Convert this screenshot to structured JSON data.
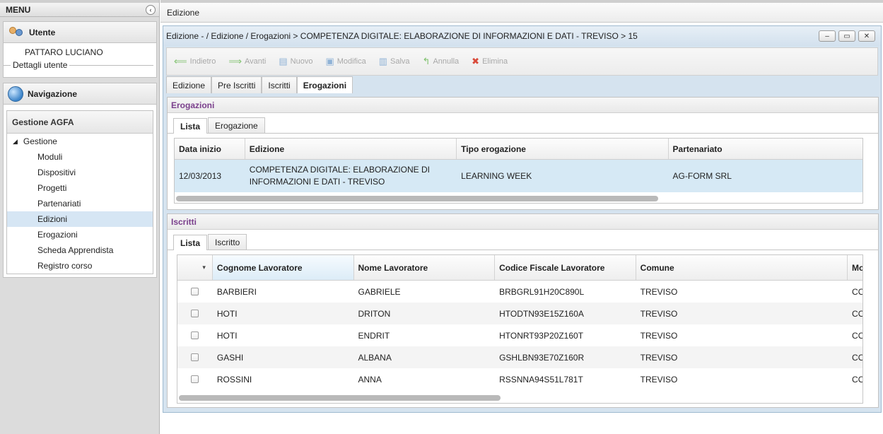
{
  "sidebar": {
    "menu_label": "MENU",
    "collapse_glyph": "‹",
    "user_panel_title": "Utente",
    "user_name": "PATTARO LUCIANO",
    "user_details_label": "Dettagli utente",
    "nav_panel_title": "Navigazione",
    "nav_group_title": "Gestione AGFA",
    "tree_root": "Gestione",
    "tree_items": [
      "Moduli",
      "Dispositivi",
      "Progetti",
      "Partenariati",
      "Edizioni",
      "Erogazioni",
      "Scheda Apprendista",
      "Registro corso"
    ],
    "selected_item": "Edizioni"
  },
  "header": {
    "tab_label": "Edizione"
  },
  "window": {
    "title": "Edizione - / Edizione / Erogazioni > COMPETENZA DIGITALE: ELABORAZIONE DI INFORMAZIONI E DATI - TREVISO > 15",
    "btn_min": "–",
    "btn_max": "▭",
    "btn_close": "✕"
  },
  "toolbar": {
    "indietro": "Indietro",
    "avanti": "Avanti",
    "nuovo": "Nuovo",
    "modifica": "Modifica",
    "salva": "Salva",
    "annulla": "Annulla",
    "elimina": "Elimina"
  },
  "main_tabs": [
    "Edizione",
    "Pre Iscritti",
    "Iscritti",
    "Erogazioni"
  ],
  "erogazioni": {
    "title": "Erogazioni",
    "tabs": [
      "Lista",
      "Erogazione"
    ],
    "columns": [
      "Data inizio",
      "Edizione",
      "Tipo erogazione",
      "Partenariato"
    ],
    "rows": [
      {
        "data_inizio": "12/03/2013",
        "edizione_line1": "COMPETENZA DIGITALE: ELABORAZIONE DI",
        "edizione_line2": "INFORMAZIONI E DATI - TREVISO",
        "tipo": "LEARNING WEEK",
        "partenariato": "AG-FORM SRL"
      }
    ]
  },
  "iscritti": {
    "title": "Iscritti",
    "tabs": [
      "Lista",
      "Iscritto"
    ],
    "columns": [
      "Cognome Lavoratore",
      "Nome Lavoratore",
      "Codice Fiscale Lavoratore",
      "Comune",
      "Mo"
    ],
    "rows": [
      {
        "cognome": "BARBIERI",
        "nome": "GABRIELE",
        "cf": "BRBGRL91H20C890L",
        "comune": "TREVISO",
        "extra": "CO"
      },
      {
        "cognome": "HOTI",
        "nome": "DRITON",
        "cf": "HTODTN93E15Z160A",
        "comune": "TREVISO",
        "extra": "CO"
      },
      {
        "cognome": "HOTI",
        "nome": "ENDRIT",
        "cf": "HTONRT93P20Z160T",
        "comune": "TREVISO",
        "extra": "CO"
      },
      {
        "cognome": "GASHI",
        "nome": "ALBANA",
        "cf": "GSHLBN93E70Z160R",
        "comune": "TREVISO",
        "extra": "CO"
      },
      {
        "cognome": "ROSSINI",
        "nome": "ANNA",
        "cf": "RSSNNA94S51L781T",
        "comune": "TREVISO",
        "extra": "CO"
      }
    ]
  },
  "colors": {
    "accent": "#7a3f8c",
    "selection": "#d6e6f4",
    "window_bg": "#d5e3ef"
  }
}
